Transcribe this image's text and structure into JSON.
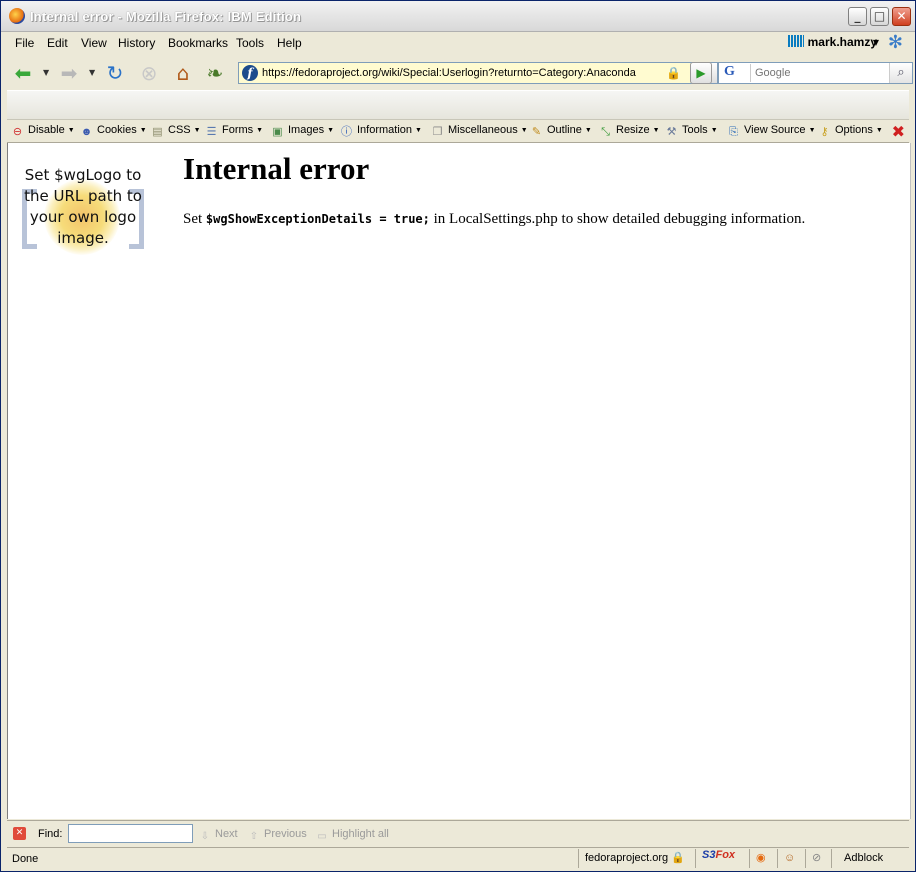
{
  "window": {
    "title": "Internal error - Mozilla Firefox: IBM Edition",
    "minimize_glyph": "_",
    "maximize_glyph": "□",
    "close_glyph": "✕"
  },
  "menu": {
    "items": [
      "File",
      "Edit",
      "View",
      "History",
      "Bookmarks",
      "Tools",
      "Help"
    ],
    "user": "mark.hamzy"
  },
  "nav": {
    "url": "https://fedoraproject.org/wiki/Special:Userlogin?returnto=Category:Anaconda",
    "search_placeholder": "Google",
    "search_engine_glyph": "G"
  },
  "devtoolbar": {
    "items": [
      "Disable",
      "Cookies",
      "CSS",
      "Forms",
      "Images",
      "Information",
      "Miscellaneous",
      "Outline",
      "Resize",
      "Tools",
      "View Source",
      "Options"
    ]
  },
  "page": {
    "logo_text": "Set $wgLogo to the URL path to your own logo image.",
    "heading": "Internal error",
    "msg_prefix": "Set ",
    "msg_code": "$wgShowExceptionDetails = true;",
    "msg_suffix": " in LocalSettings.php to show detailed debugging information."
  },
  "findbar": {
    "label": "Find:",
    "value": "",
    "next": "Next",
    "previous": "Previous",
    "highlight": "Highlight all"
  },
  "status": {
    "text": "Done",
    "domain": "fedoraproject.org",
    "s3fox_a": "S3",
    "s3fox_b": "Fox",
    "adblock": "Adblock"
  },
  "colors": {
    "title_blue": "#0a246a",
    "dev_close": "#d02020"
  }
}
